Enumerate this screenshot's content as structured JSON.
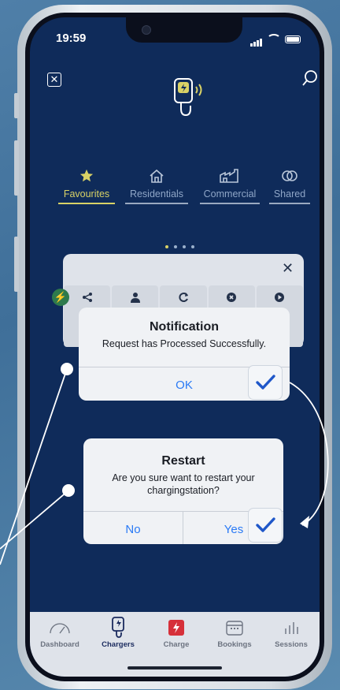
{
  "status_bar": {
    "time": "19:59"
  },
  "header": {
    "close_icon": "close-icon",
    "search_icon": "search-icon",
    "logo_icon": "ev-charger-icon"
  },
  "tabs": [
    {
      "label": "Favourites",
      "icon": "star-icon",
      "active": true
    },
    {
      "label": "Residentials",
      "icon": "house-icon",
      "active": false
    },
    {
      "label": "Commercial",
      "icon": "factory-icon",
      "active": false
    },
    {
      "label": "Shared",
      "icon": "shared-rings-icon",
      "active": false
    }
  ],
  "pager": {
    "count": 4,
    "current": 1
  },
  "charger_card": {
    "actions": [
      "share-icon",
      "user-icon",
      "refresh-icon",
      "stop-icon",
      "play-icon"
    ]
  },
  "notification_dialog": {
    "title": "Notification",
    "message": "Request has Processed Successfully.",
    "ok_label": "OK"
  },
  "restart_dialog": {
    "title": "Restart",
    "message": "Are you sure want to restart your chargingstation?",
    "no_label": "No",
    "yes_label": "Yes"
  },
  "tabbar": {
    "items": [
      {
        "label": "Dashboard",
        "icon": "gauge-icon"
      },
      {
        "label": "Chargers",
        "icon": "charger-icon"
      },
      {
        "label": "Charge",
        "icon": "bolt-square-icon"
      },
      {
        "label": "Bookings",
        "icon": "calendar-icon"
      },
      {
        "label": "Sessions",
        "icon": "bar-chart-icon"
      }
    ],
    "active_index": 1
  },
  "colors": {
    "screen_bg": "#0f2b5a",
    "accent_yellow": "#d9d266",
    "ios_blue": "#2a7af5",
    "check_blue": "#1f57c9",
    "charge_red": "#d6303a"
  }
}
